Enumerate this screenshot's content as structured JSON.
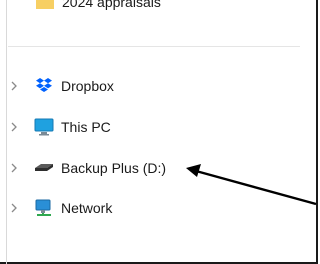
{
  "top_folder": {
    "label": "2024 appraisals",
    "icon": "folder-icon"
  },
  "nav_items": [
    {
      "label": "Dropbox",
      "icon": "dropbox-icon"
    },
    {
      "label": "This PC",
      "icon": "monitor-icon"
    },
    {
      "label": "Backup Plus (D:)",
      "icon": "drive-icon"
    },
    {
      "label": "Network",
      "icon": "network-icon"
    }
  ],
  "colors": {
    "folder": "#f2c14e",
    "dropbox": "#0061fe",
    "monitor": "#1fa1e0",
    "drive": "#3a3a3a",
    "network": "#2a8fd6",
    "chevron": "#8a8a8a",
    "arrow": "#000000"
  }
}
